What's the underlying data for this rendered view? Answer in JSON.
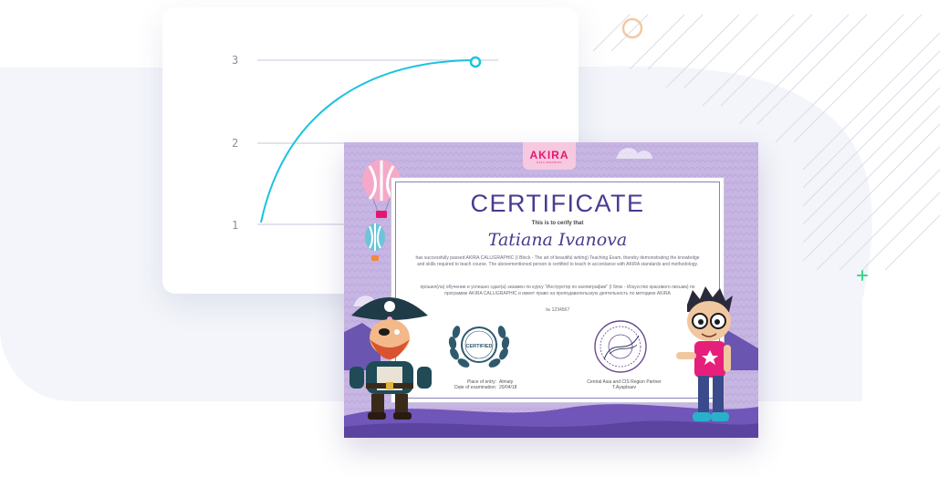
{
  "colors": {
    "curve": "#19c3e2",
    "certificate_frame": "#c7b5e3",
    "title": "#4b3a8f",
    "brand": "#e4176e",
    "sparkle": "#3dd68c",
    "ring": "#f2c9a3"
  },
  "progress_chart": {
    "y_ticks": [
      "3",
      "2",
      "1"
    ]
  },
  "certificate": {
    "brand": "AKIRA",
    "brand_sub": "CALLIGRAPHIC",
    "title": "CERTIFICATE",
    "subtitle": "This is to cerify that",
    "name": "Tatiana Ivanova",
    "body_en": "has successfully passed AKIRA CALLIGRAPHIC (I Block - The art of beautiful writing) Teaching Exam, thereby demonstrating the knowledge and skills required to teach course. The abovementioned person is certified to teach in accordance with AKIRA standards and methodology.",
    "body_ru": "прошел(ла) обучение и успешно сдал(а) экзамен по курсу \"Инструктор по каллиграфии\" (I блок - Искусство красивого письма) по программе AKIRA CALLIGRAPHIC и имеет право на преподавательскую деятельность по методике AKIRA",
    "number": "№ 1234567",
    "badge_text": "CERTIFIED",
    "place_label": "Place of entry:",
    "place_value": "Almaty",
    "date_label": "Date of examination:",
    "date_value": "20/04/18",
    "partner_line": "Central Asia and CIS Region Partner",
    "partner_name": "T.Ayapbaev"
  },
  "icons": {
    "sparkle": "sparkle-icon",
    "ring": "ring-decoration",
    "balloons": "hot-air-balloon-icon",
    "pirate": "pirate-character",
    "boy": "boy-character",
    "stamp": "stamp-seal",
    "badge": "certified-badge"
  }
}
